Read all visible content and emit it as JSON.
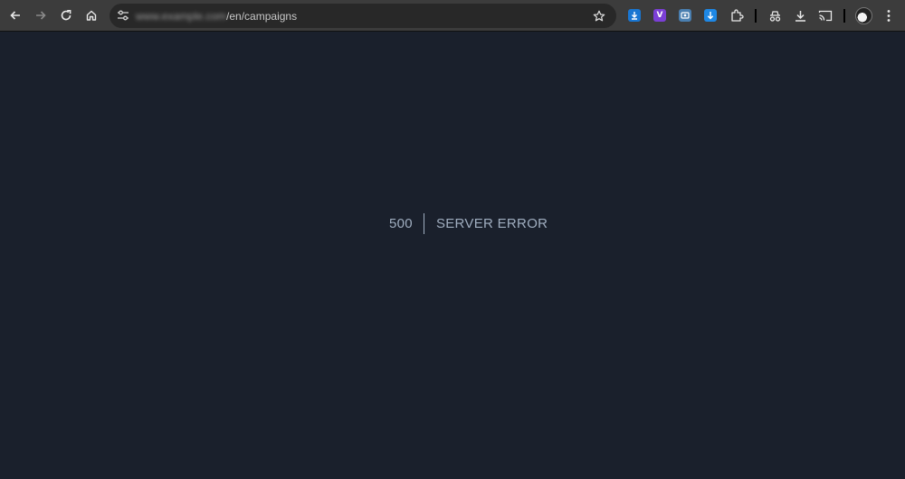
{
  "browser": {
    "url_host": "www.example.com",
    "url_path": "/en/campaigns",
    "extension_badges": {
      "vim": "V"
    },
    "colors": {
      "ext_download": "#1976d2",
      "ext_vim": "#7b3fd6",
      "ext_screen": "#4a7fb0",
      "ext_arrow": "#1e88e5"
    }
  },
  "error": {
    "code": "500",
    "message": "SERVER ERROR"
  }
}
